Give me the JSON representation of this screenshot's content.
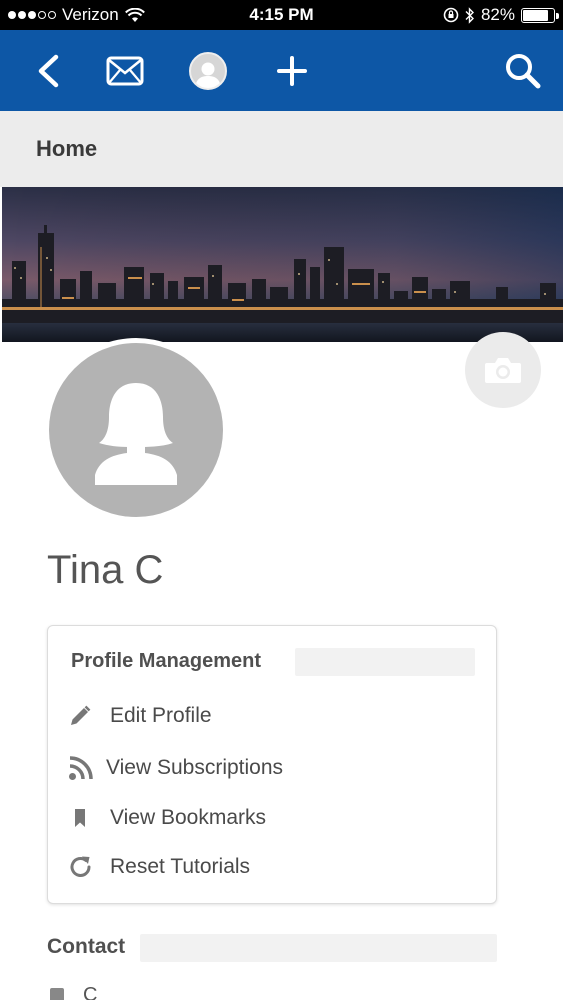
{
  "status_bar": {
    "carrier": "Verizon",
    "time": "4:15 PM",
    "battery": "82%",
    "battery_level": 0.82,
    "signal_bars_filled": 3,
    "signal_bars_total": 5
  },
  "nav": {
    "icons": [
      "back-icon",
      "mail-icon",
      "user-avatar-icon",
      "plus-icon",
      "search-icon"
    ],
    "color": "#0d57a6"
  },
  "breadcrumb": {
    "title": "Home"
  },
  "profile": {
    "name": "Tina C"
  },
  "profile_management": {
    "title": "Profile Management",
    "items": [
      {
        "label": "Edit Profile",
        "icon": "pencil-icon"
      },
      {
        "label": "View Subscriptions",
        "icon": "rss-icon"
      },
      {
        "label": "View Bookmarks",
        "icon": "bookmark-icon"
      },
      {
        "label": "Reset Tutorials",
        "icon": "refresh-icon"
      }
    ]
  },
  "contact": {
    "title": "Contact",
    "first_item": "C"
  }
}
